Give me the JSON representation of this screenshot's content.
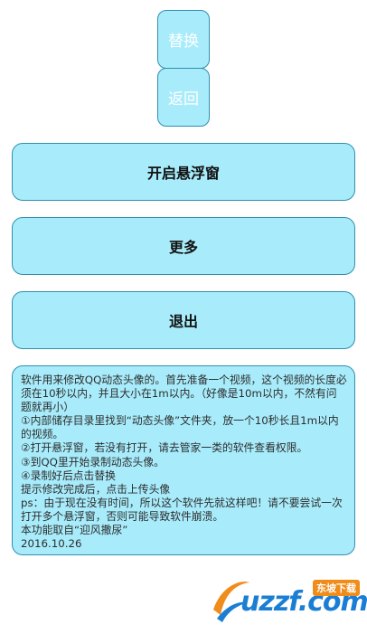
{
  "buttons": {
    "replace": "替换",
    "back": "返回",
    "open_float": "开启悬浮窗",
    "more": "更多",
    "exit": "退出"
  },
  "info": {
    "lines": [
      "软件用来修改QQ动态头像的。首先准备一个视频，这个视频的长度必须在10秒以内，并且大小在1m以内。（好像是10m以内，不然有问题就再小）",
      "①内部储存目录里找到“动态头像”文件夹，放一个10秒长且1m以内的视频。",
      "②打开悬浮窗，若没有打开，请去管家一类的软件查看权限。",
      "③到QQ里开始录制动态头像。",
      "④录制好后点击替换",
      "提示修改完成后，点击上传头像",
      "ps：由于现在没有时间，所以这个软件先就这样吧！请不要尝试一次打开多个悬浮窗，否则可能导致软件崩溃。",
      "本功能取自“迎风撒尿”",
      "2016.10.26"
    ]
  },
  "watermark": {
    "logo_text": "uzzf.com",
    "badge_text": "东坡下载"
  },
  "colors": {
    "button_fill": "#a8ecfb",
    "button_border": "#2f8fb0",
    "logo_blue": "#1a7fd4",
    "logo_orange": "#f08c1a"
  }
}
